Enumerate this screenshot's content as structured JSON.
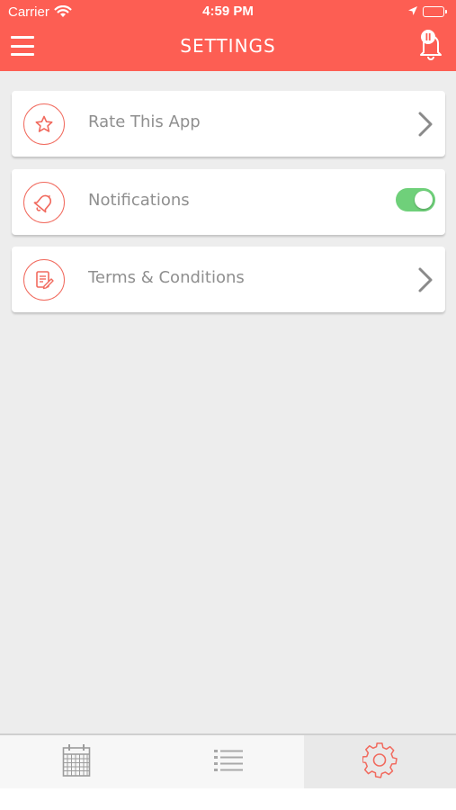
{
  "status_bar": {
    "carrier": "Carrier",
    "time": "4:59 PM"
  },
  "header": {
    "title": "SETTINGS",
    "background_color": "#fd5e53",
    "left_icon": "menu-icon",
    "right_icon": "bell-pause-icon"
  },
  "settings": [
    {
      "label": "Rate This App",
      "icon": "star-icon",
      "accessory": "chevron-right-icon"
    },
    {
      "label": "Notifications",
      "icon": "bell-icon",
      "accessory": "toggle",
      "toggle_on": true
    },
    {
      "label": "Terms & Conditions",
      "icon": "document-edit-icon",
      "accessory": "chevron-right-icon"
    }
  ],
  "tabbar": {
    "tabs": [
      {
        "icon": "calendar-icon",
        "active": false
      },
      {
        "icon": "list-icon",
        "active": false
      },
      {
        "icon": "gear-icon",
        "active": true
      }
    ]
  },
  "colors": {
    "accent": "#f16a5e",
    "toggle_on": "#6fd07a",
    "background": "#ededed"
  }
}
